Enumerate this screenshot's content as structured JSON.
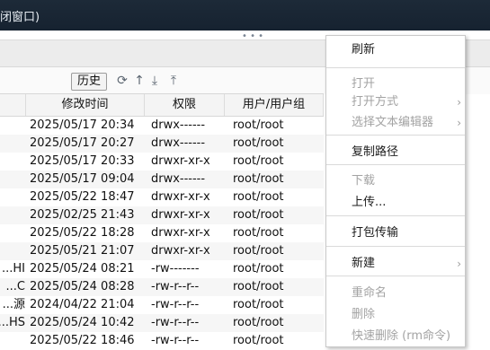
{
  "window": {
    "title": "闭窗口)"
  },
  "toolbar": {
    "history_label": "历史",
    "icons": [
      "refresh-icon",
      "up-arrow-icon",
      "download-icon",
      "upload-icon"
    ]
  },
  "table": {
    "headers": [
      "",
      "修改时间",
      "权限",
      "用户/用户组"
    ],
    "rows": [
      {
        "name": "",
        "time": "2025/05/17 20:34",
        "perm": "drwx------",
        "owner": "root/root"
      },
      {
        "name": "",
        "time": "2025/05/17 20:27",
        "perm": "drwx------",
        "owner": "root/root"
      },
      {
        "name": "",
        "time": "2025/05/17 20:33",
        "perm": "drwxr-xr-x",
        "owner": "root/root"
      },
      {
        "name": "",
        "time": "2025/05/17 09:04",
        "perm": "drwx------",
        "owner": "root/root"
      },
      {
        "name": "",
        "time": "2025/05/22 18:47",
        "perm": "drwxr-xr-x",
        "owner": "root/root"
      },
      {
        "name": "",
        "time": "2025/02/25 21:43",
        "perm": "drwxr-xr-x",
        "owner": "root/root"
      },
      {
        "name": "",
        "time": "2025/05/22 18:28",
        "perm": "drwxr-xr-x",
        "owner": "root/root"
      },
      {
        "name": "",
        "time": "2025/05/21 21:07",
        "perm": "drwxr-xr-x",
        "owner": "root/root"
      },
      {
        "name": "HI...",
        "time": "2025/05/24 08:21",
        "perm": "-rw-------",
        "owner": "root/root"
      },
      {
        "name": "C...",
        "time": "2025/05/24 08:28",
        "perm": "-rw-r--r--",
        "owner": "root/root"
      },
      {
        "name": "源...",
        "time": "2024/04/22 21:04",
        "perm": "-rw-r--r--",
        "owner": "root/root"
      },
      {
        "name": "HS...",
        "time": "2025/05/24 10:42",
        "perm": "-rw-r--r--",
        "owner": "root/root"
      },
      {
        "name": "",
        "time": "2025/05/22 18:46",
        "perm": "-rw-r--r--",
        "owner": "root/root"
      }
    ]
  },
  "context_menu": {
    "items": [
      {
        "label": "刷新",
        "enabled": true
      },
      {
        "label": "打开",
        "enabled": false
      },
      {
        "label": "打开方式",
        "enabled": false,
        "submenu": true
      },
      {
        "label": "选择文本编辑器",
        "enabled": false,
        "submenu": true
      },
      {
        "label": "复制路径",
        "enabled": true
      },
      {
        "label": "下载",
        "enabled": false
      },
      {
        "label": "上传...",
        "enabled": true
      },
      {
        "label": "打包传输",
        "enabled": true
      },
      {
        "label": "新建",
        "enabled": true,
        "submenu": true
      },
      {
        "label": "重命名",
        "enabled": false
      },
      {
        "label": "删除",
        "enabled": false
      },
      {
        "label": "快速删除 (rm命令)",
        "enabled": false
      }
    ]
  }
}
